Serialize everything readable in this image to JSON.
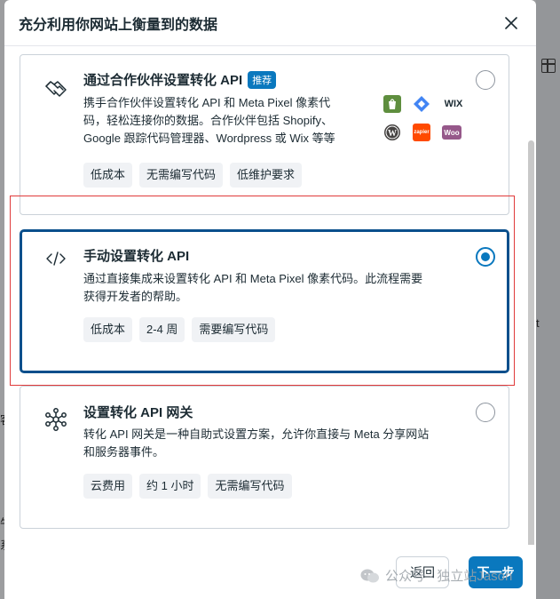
{
  "modal": {
    "title": "充分利用你网站上衡量到的数据"
  },
  "options": [
    {
      "title": "通过合作伙伴设置转化 API",
      "badge": "推荐",
      "description_line1": "携手合作伙伴设置转化 API 和 Meta Pixel 像素代",
      "description_line2": "码，轻松连接你的数据。合作伙伴包括 Shopify、",
      "description_line3": "Google 跟踪代码管理器、Wordpress 或 Wix 等等",
      "tags": [
        "低成本",
        "无需编写代码",
        "低维护要求"
      ],
      "icon": "handshake-icon",
      "selected": false
    },
    {
      "title": "手动设置转化 API",
      "description_line1": "通过直接集成来设置转化 API 和 Meta Pixel 像素代码。此流程需要",
      "description_line2": "获得开发者的帮助。",
      "tags": [
        "低成本",
        "2-4 周",
        "需要编写代码"
      ],
      "icon": "code-icon",
      "selected": true
    },
    {
      "title": "设置转化 API 网关",
      "description_line1": "转化 API 网关是一种自助式设置方案，允许你直接与 Meta 分享网站",
      "description_line2": "和服务器事件。",
      "tags": [
        "云费用",
        "约 1 小时",
        "无需编写代码"
      ],
      "icon": "network-hub-icon",
      "selected": false
    }
  ],
  "partner_logos": {
    "wix": "WIX",
    "zapier": "zapier",
    "woo": "Woo"
  },
  "footer": {
    "back_label": "返回",
    "next_label": "下一步"
  },
  "watermark": {
    "text": "公众号 · 独立站Jason"
  },
  "background": {
    "frag_1": "t",
    "frag_2": "客",
    "frag_3": "牛",
    "frag_4": "系"
  },
  "colors": {
    "accent": "#0a78be",
    "selected_border": "#0a4f8c",
    "highlight": "#e03a3a"
  }
}
